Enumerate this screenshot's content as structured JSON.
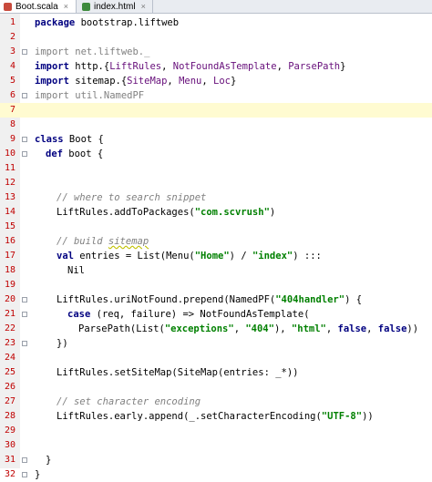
{
  "tabs": [
    {
      "label": "Boot.scala",
      "active": true,
      "icon": "scala-file-icon",
      "icon_color": "#c84a3c"
    },
    {
      "label": "index.html",
      "active": false,
      "icon": "html-file-icon",
      "icon_color": "#3d8a3d"
    }
  ],
  "close_glyph": "×",
  "current_line": 7,
  "line_numbers": [
    "1",
    "2",
    "3",
    "4",
    "5",
    "6",
    "7",
    "8",
    "9",
    "10",
    "11",
    "12",
    "13",
    "14",
    "15",
    "16",
    "17",
    "18",
    "19",
    "20",
    "21",
    "22",
    "23",
    "24",
    "25",
    "26",
    "27",
    "28",
    "29",
    "30",
    "31",
    "32"
  ],
  "code": {
    "l1": [
      "package",
      " bootstrap.liftweb"
    ],
    "l3": [
      "import",
      " net.liftweb._"
    ],
    "l4": [
      "import",
      " http.{",
      "LiftRules",
      ", ",
      "NotFoundAsTemplate",
      ", ",
      "ParsePath",
      "}"
    ],
    "l5": [
      "import",
      " sitemap.{",
      "SiteMap",
      ", ",
      "Menu",
      ", ",
      "Loc",
      "}"
    ],
    "l6": [
      "import",
      " util.NamedPF"
    ],
    "l9": [
      "class",
      " Boot {"
    ],
    "l10": [
      "def",
      " boot {"
    ],
    "l13": [
      "// where to search snippet"
    ],
    "l14": [
      "LiftRules.addToPackages(",
      "\"com.scvrush\"",
      ")"
    ],
    "l16": [
      "// build ",
      "sitemap"
    ],
    "l17": [
      "val",
      " entries = List(Menu(",
      "\"Home\"",
      ") / ",
      "\"index\"",
      ") :::"
    ],
    "l18": [
      "Nil"
    ],
    "l20": [
      "LiftRules.uriNotFound.prepend(NamedPF(",
      "\"404handler\"",
      ") {"
    ],
    "l21": [
      "case",
      " (req, failure) => NotFoundAsTemplate("
    ],
    "l22": [
      "ParsePath(List(",
      "\"exceptions\"",
      ", ",
      "\"404\"",
      "), ",
      "\"html\"",
      ", ",
      "false",
      ", ",
      "false",
      "))"
    ],
    "l23": [
      "})"
    ],
    "l25": [
      "LiftRules.setSiteMap(SiteMap(entries: _*))"
    ],
    "l27": [
      "// set character encoding"
    ],
    "l28": [
      "LiftRules.early.append(_.setCharacterEncoding(",
      "\"UTF-8\"",
      "))"
    ],
    "l31": [
      "}"
    ],
    "l32": [
      "}"
    ]
  }
}
